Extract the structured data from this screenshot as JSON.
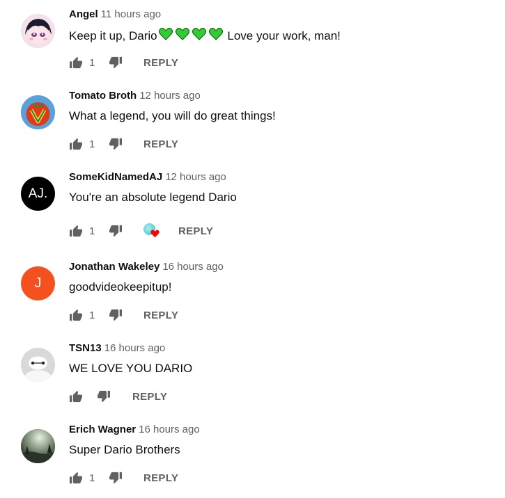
{
  "comments": [
    {
      "author": "Angel",
      "time": "11 hours ago",
      "text_before": "Keep it up, Dario",
      "text_after": " Love your work, man!",
      "emoji_count": 4,
      "emoji": "green-heart",
      "likes": "1",
      "reply_label": "REPLY",
      "avatar": {
        "type": "anime-face"
      }
    },
    {
      "author": "Tomato Broth",
      "time": "12 hours ago",
      "text": "What a legend, you will do great things!",
      "likes": "1",
      "reply_label": "REPLY",
      "avatar": {
        "type": "tomato",
        "letter": "V"
      }
    },
    {
      "author": "SomeKidNamedAJ",
      "time": "12 hours ago",
      "text": "You're an absolute legend Dario",
      "likes": "1",
      "reply_label": "REPLY",
      "creator_heart": true,
      "avatar": {
        "type": "text",
        "label": "AJ.",
        "bg": "#000000",
        "fg": "#ffffff"
      }
    },
    {
      "author": "Jonathan Wakeley",
      "time": "16 hours ago",
      "text": "goodvideokeepitup!",
      "likes": "1",
      "reply_label": "REPLY",
      "avatar": {
        "type": "letter",
        "label": "J",
        "bg": "#f4511e",
        "fg": "#ffffff"
      }
    },
    {
      "author": "TSN13",
      "time": "16 hours ago",
      "text": "WE LOVE YOU DARIO",
      "likes": "",
      "reply_label": "REPLY",
      "avatar": {
        "type": "baymax"
      }
    },
    {
      "author": "Erich Wagner",
      "time": "16 hours ago",
      "text": "Super Dario Brothers",
      "likes": "1",
      "reply_label": "REPLY",
      "avatar": {
        "type": "landscape"
      }
    }
  ],
  "colors": {
    "text": "#0f0f0f",
    "secondary": "#606060",
    "green_heart": "#2ecc2e",
    "red_heart": "#ff0000"
  }
}
